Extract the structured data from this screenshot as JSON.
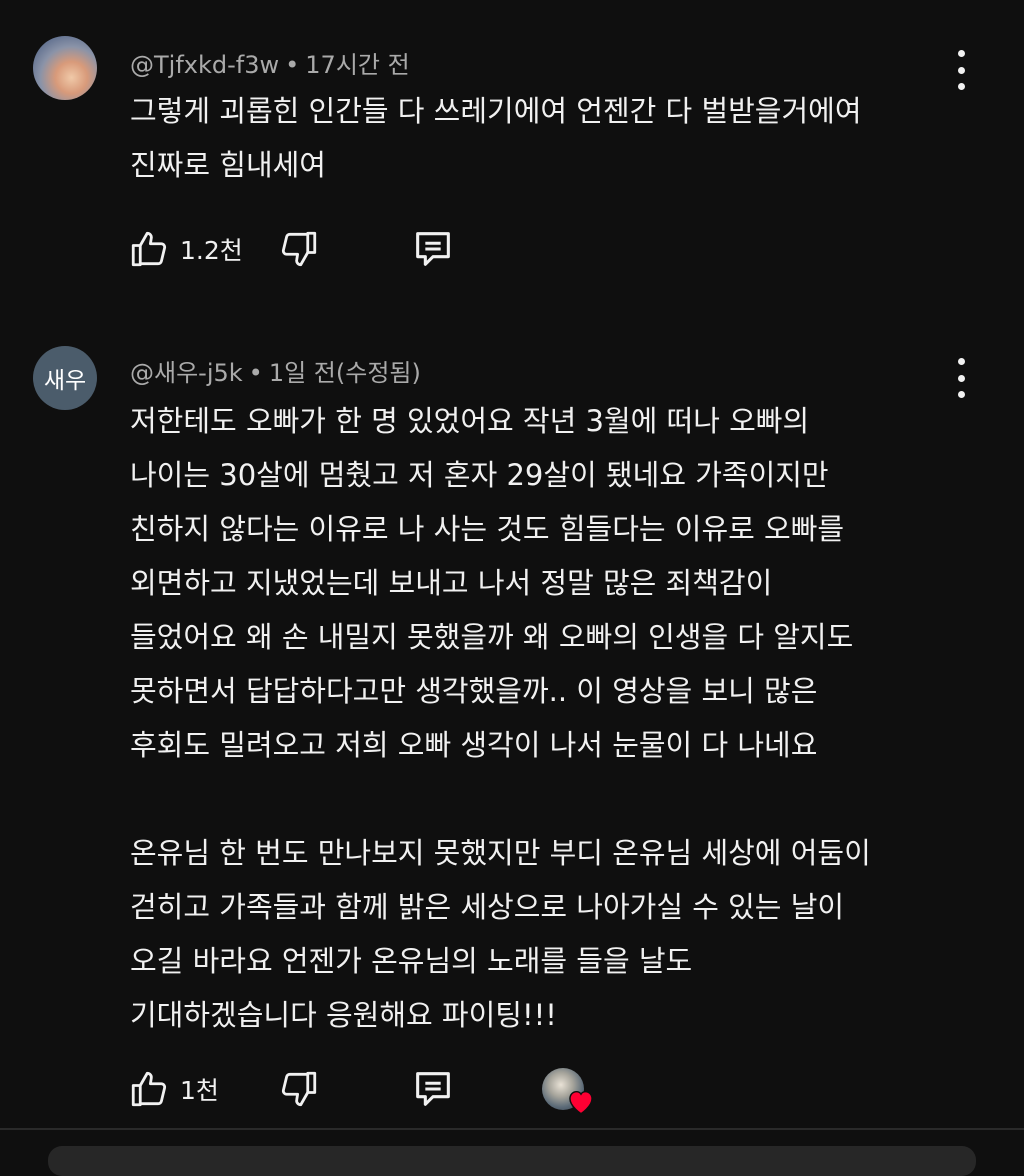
{
  "comments": [
    {
      "author": "@Tjfxkd-f3w",
      "time": "17시간 전",
      "text": "그렇게 괴롭힌 인간들 다 쓰레기에여 언젠간 다 벌받을거에여\n진짜로 힘내세여",
      "likes": "1.2천",
      "avatar_initial": ""
    },
    {
      "author": "@새우-j5k",
      "time": "1일 전(수정됨)",
      "text": "저한테도 오빠가 한 명 있었어요 작년 3월에 떠나 오빠의\n나이는 30살에 멈췄고 저 혼자 29살이 됐네요 가족이지만\n친하지 않다는 이유로 나 사는 것도 힘들다는 이유로 오빠를\n외면하고 지냈었는데 보내고 나서 정말 많은 죄책감이\n들었어요 왜 손 내밀지 못했을까 왜 오빠의 인생을 다 알지도\n못하면서 답답하다고만 생각했을까.. 이 영상을 보니 많은\n후회도 밀려오고 저희 오빠 생각이 나서 눈물이 다 나네요\n\n온유님 한 번도 만나보지 못했지만 부디 온유님 세상에 어둠이\n걷히고 가족들과 함께 밝은 세상으로 나아가실 수 있는 날이\n오길 바라요 언젠가 온유님의 노래를 들을 날도\n기대하겠습니다 응원해요 파이팅!!!",
      "likes": "1천",
      "avatar_initial": "새우"
    }
  ],
  "meta_separator": "•",
  "icons": {
    "like": "thumbs-up-icon",
    "dislike": "thumbs-down-icon",
    "reply": "reply-comment-icon",
    "more": "more-vertical-icon",
    "heart": "creator-heart-icon"
  },
  "colors": {
    "background": "#0f0f0f",
    "text": "#f1f1f1",
    "meta": "#aaaaaa",
    "heart": "#ff0033"
  }
}
